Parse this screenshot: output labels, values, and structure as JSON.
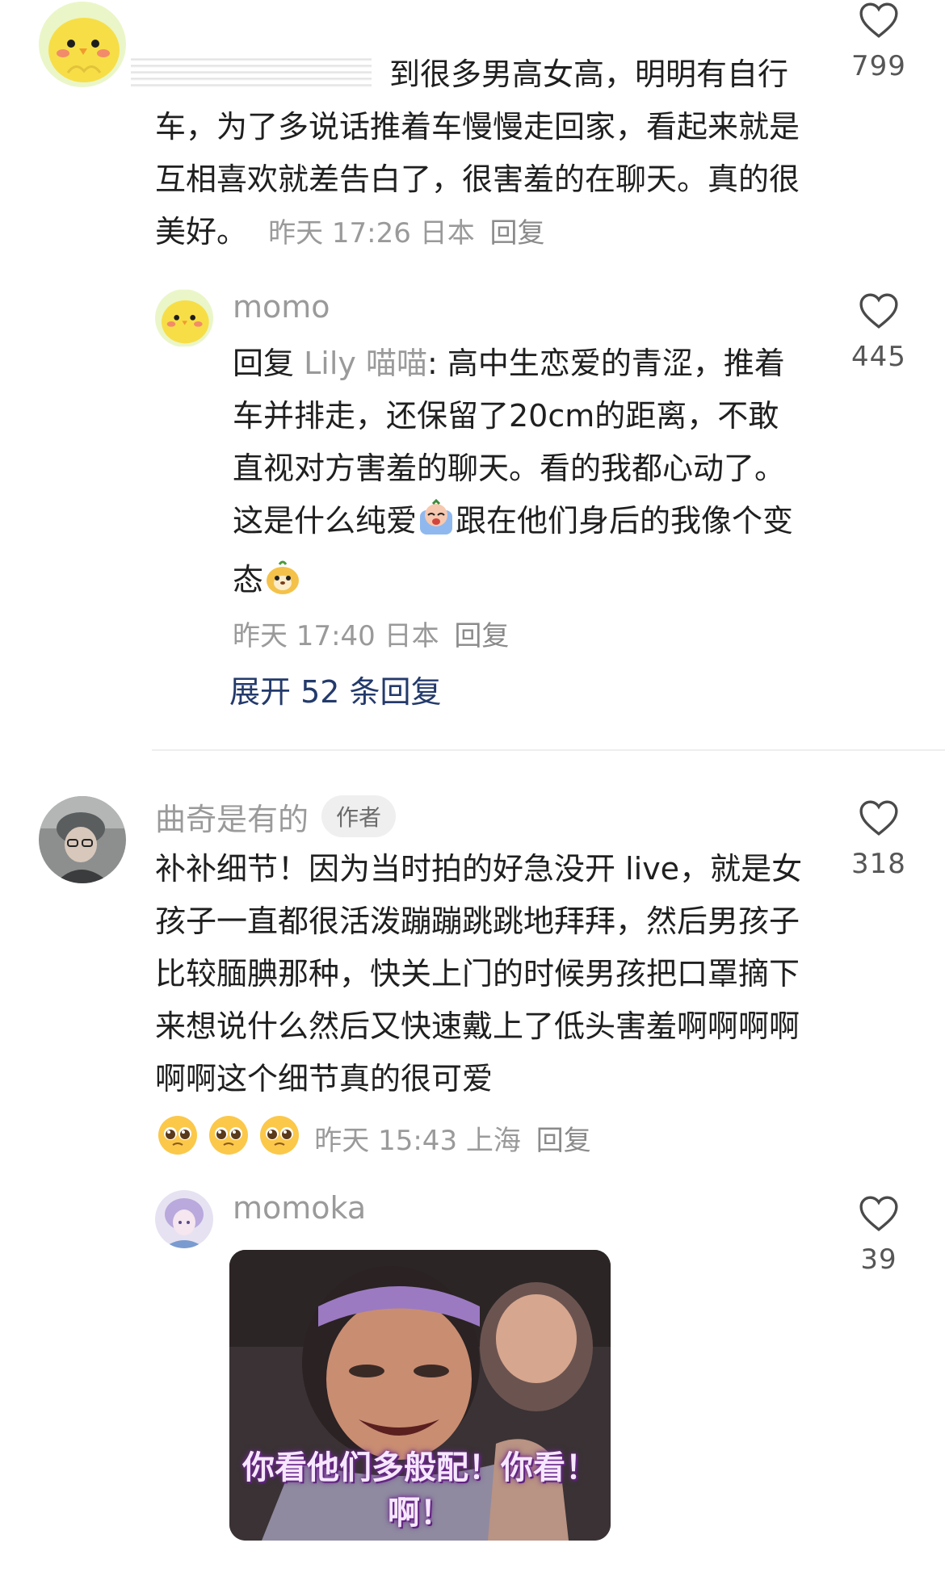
{
  "comments": [
    {
      "text_tail": "到很多男高女高，明明有自行车，为了多说话推着车慢慢走回家，看起来就是互相喜欢就差告白了，很害羞的在聊天。真的很美好。",
      "time": "昨天 17:26",
      "location": "日本",
      "reply_label": "回复",
      "likes": "799"
    },
    {
      "username": "momo",
      "reply_prefix": "回复",
      "reply_to": "Lily 喵喵",
      "text": ": 高中生恋爱的青涩，推着车并排走，还保留了20cm的距离，不敢直视对方害羞的聊天。看的我都心动了。这是什么纯爱",
      "text2": "跟在他们身后的我像个变态",
      "time": "昨天 17:40",
      "location": "日本",
      "reply_label": "回复",
      "likes": "445"
    },
    {
      "username": "曲奇是有的",
      "badge": "作者",
      "text": "补补细节！因为当时拍的好急没开 live，就是女孩子一直都很活泼蹦蹦跳跳地拜拜，然后男孩子比较腼腆那种，快关上门的时候男孩把口罩摘下来想说什么然后又快速戴上了低头害羞啊啊啊啊啊啊这个细节真的很可爱",
      "time": "昨天 15:43",
      "location": "上海",
      "reply_label": "回复",
      "likes": "318"
    },
    {
      "username": "momoka",
      "meme_caption": "你看他们多般配！你看！啊！",
      "likes": "39"
    }
  ],
  "expand_replies": "展开 52 条回复",
  "icons": {
    "like": "heart-outline-icon",
    "pleading": "pleading-face-icon"
  },
  "colors": {
    "expand_link": "#233a6b",
    "meta_gray": "#9a9a9a"
  }
}
